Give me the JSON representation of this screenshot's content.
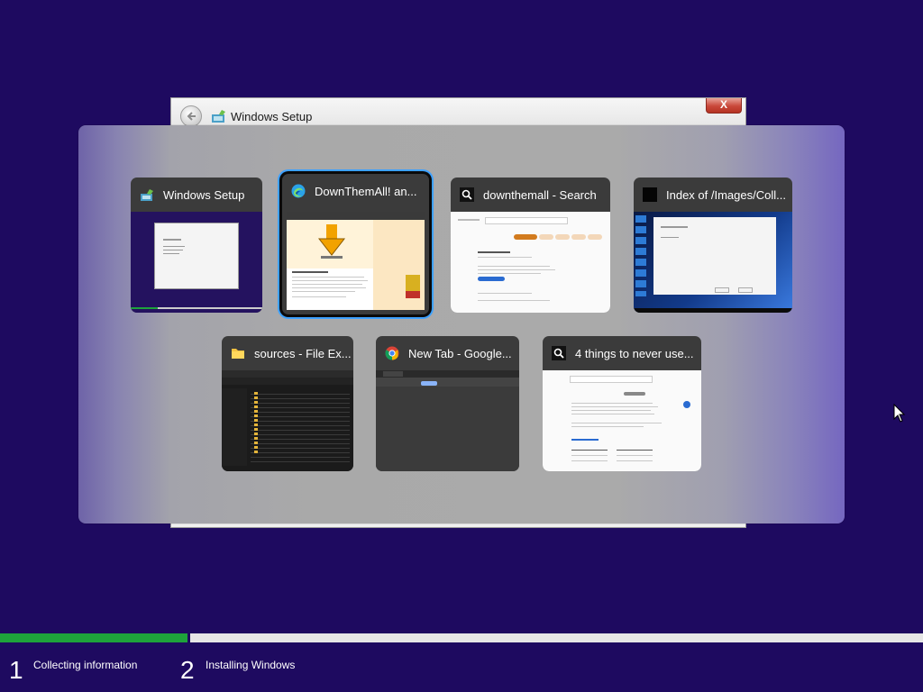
{
  "setup_window": {
    "title": "Windows Setup",
    "close_symbol": "X"
  },
  "switcher": {
    "tiles": [
      {
        "title": "Windows Setup",
        "icon": "windows-setup-icon",
        "selected": false
      },
      {
        "title": "DownThemAll! an...",
        "icon": "edge-icon",
        "selected": true
      },
      {
        "title": "downthemall - Search",
        "icon": "search-icon",
        "selected": false
      },
      {
        "title": "Index of /Images/Coll...",
        "icon": "app-black-icon",
        "selected": false
      },
      {
        "title": "sources - File Ex...",
        "icon": "folder-icon",
        "selected": false
      },
      {
        "title": "New Tab - Google...",
        "icon": "chrome-icon",
        "selected": false
      },
      {
        "title": "4 things to never use...",
        "icon": "search-icon",
        "selected": false
      }
    ]
  },
  "setup_progress": {
    "percent": 20.5,
    "steps": [
      {
        "number": "1",
        "label": "Collecting information"
      },
      {
        "number": "2",
        "label": "Installing Windows"
      }
    ]
  },
  "colors": {
    "background": "#1e0a60",
    "progress": "#1ea33b",
    "selection": "#3da1ff"
  }
}
